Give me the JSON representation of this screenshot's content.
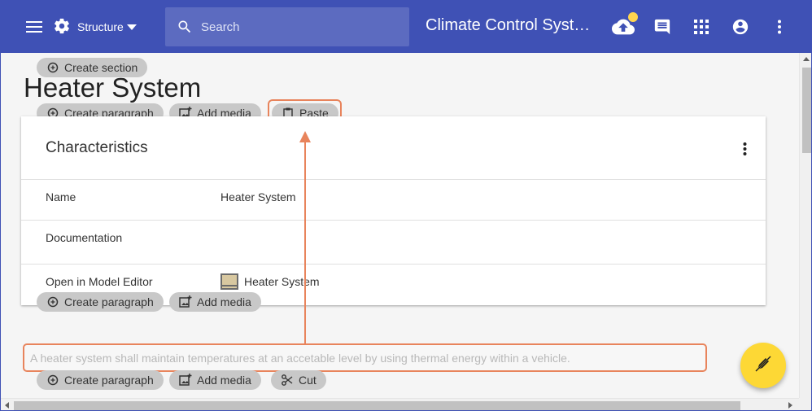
{
  "appbar": {
    "structure_label": "Structure",
    "search_placeholder": "Search",
    "title": "Climate Control System",
    "colors": {
      "bar": "#3f51b5",
      "search": "#5c6bc0",
      "badge": "#ffd54f"
    }
  },
  "page": {
    "create_section_label": "Create section",
    "title": "Heater System",
    "top_actions": {
      "create_paragraph": "Create paragraph",
      "add_media": "Add media",
      "paste": "Paste"
    }
  },
  "card": {
    "title": "Characteristics",
    "rows": [
      {
        "label": "Name",
        "value": "Heater System"
      },
      {
        "label": "Documentation",
        "value": ""
      },
      {
        "label": "Open in Model Editor",
        "value": "Heater System",
        "icon": "model-diagram-icon"
      }
    ]
  },
  "mid_actions": {
    "create_paragraph": "Create paragraph",
    "add_media": "Add media"
  },
  "paragraph": {
    "text": "A heater system shall maintain temperatures at an accetable level by using thermal energy within a vehicle."
  },
  "bottom_actions": {
    "create_paragraph": "Create paragraph",
    "add_media": "Add media",
    "cut": "Cut"
  },
  "accent": {
    "annotation": "#e8845c",
    "fab": "#fdd835"
  }
}
